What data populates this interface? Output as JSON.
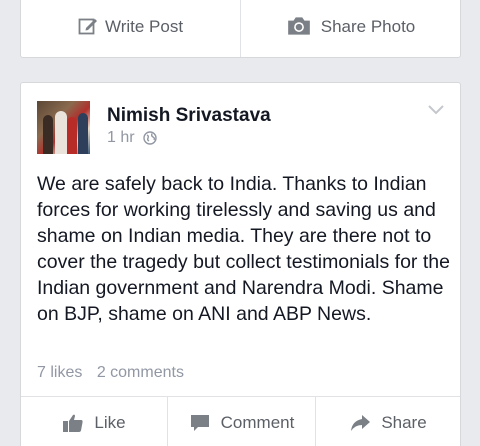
{
  "composer": {
    "write_post": "Write Post",
    "share_photo": "Share Photo"
  },
  "post": {
    "author": "Nimish Srivastava",
    "time": "1 hr",
    "text": "We are safely back to India. Thanks to Indian forces for working tirelessly and saving us and shame on Indian media. They are there not to cover the tragedy but collect testimonials for the Indian government and Narendra Modi. Shame on BJP, shame on ANI and ABP News.",
    "likes": "7 likes",
    "comments": "2 comments"
  },
  "actions": {
    "like": "Like",
    "comment": "Comment",
    "share": "Share"
  },
  "icons": {
    "write": "pencil-icon",
    "photo": "camera-icon",
    "privacy": "globe-icon",
    "menu": "chevron-down-icon",
    "like": "thumbs-up-icon",
    "comment": "speech-bubble-icon",
    "share": "share-arrow-icon"
  },
  "colors": {
    "background": "#e9eaee",
    "card": "#ffffff",
    "text": "#141823",
    "muted": "#9197a3",
    "action_text": "#5b5f66"
  }
}
